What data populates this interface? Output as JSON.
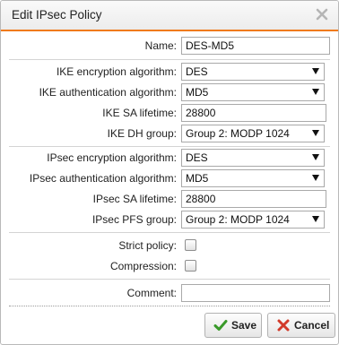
{
  "dialog": {
    "title": "Edit IPsec Policy",
    "close_icon": "close-x-icon",
    "accent_color": "#f07a1a"
  },
  "form": {
    "name": {
      "label": "Name:",
      "value": "DES-MD5"
    },
    "ike_encryption": {
      "label": "IKE encryption algorithm:",
      "value": "DES"
    },
    "ike_authentication": {
      "label": "IKE authentication algorithm:",
      "value": "MD5"
    },
    "ike_sa_lifetime": {
      "label": "IKE SA lifetime:",
      "value": "28800"
    },
    "ike_dh_group": {
      "label": "IKE DH group:",
      "value": "Group 2: MODP 1024"
    },
    "ipsec_encryption": {
      "label": "IPsec encryption algorithm:",
      "value": "DES"
    },
    "ipsec_authentication": {
      "label": "IPsec authentication algorithm:",
      "value": "MD5"
    },
    "ipsec_sa_lifetime": {
      "label": "IPsec SA lifetime:",
      "value": "28800"
    },
    "ipsec_pfs_group": {
      "label": "IPsec PFS group:",
      "value": "Group 2: MODP 1024"
    },
    "strict_policy": {
      "label": "Strict policy:",
      "checked": false
    },
    "compression": {
      "label": "Compression:",
      "checked": false
    },
    "comment": {
      "label": "Comment:",
      "value": ""
    }
  },
  "buttons": {
    "save": {
      "label": "Save",
      "icon": "checkmark-icon",
      "icon_color": "#3a9a2a"
    },
    "cancel": {
      "label": "Cancel",
      "icon": "x-icon",
      "icon_color": "#d23a2a"
    }
  }
}
